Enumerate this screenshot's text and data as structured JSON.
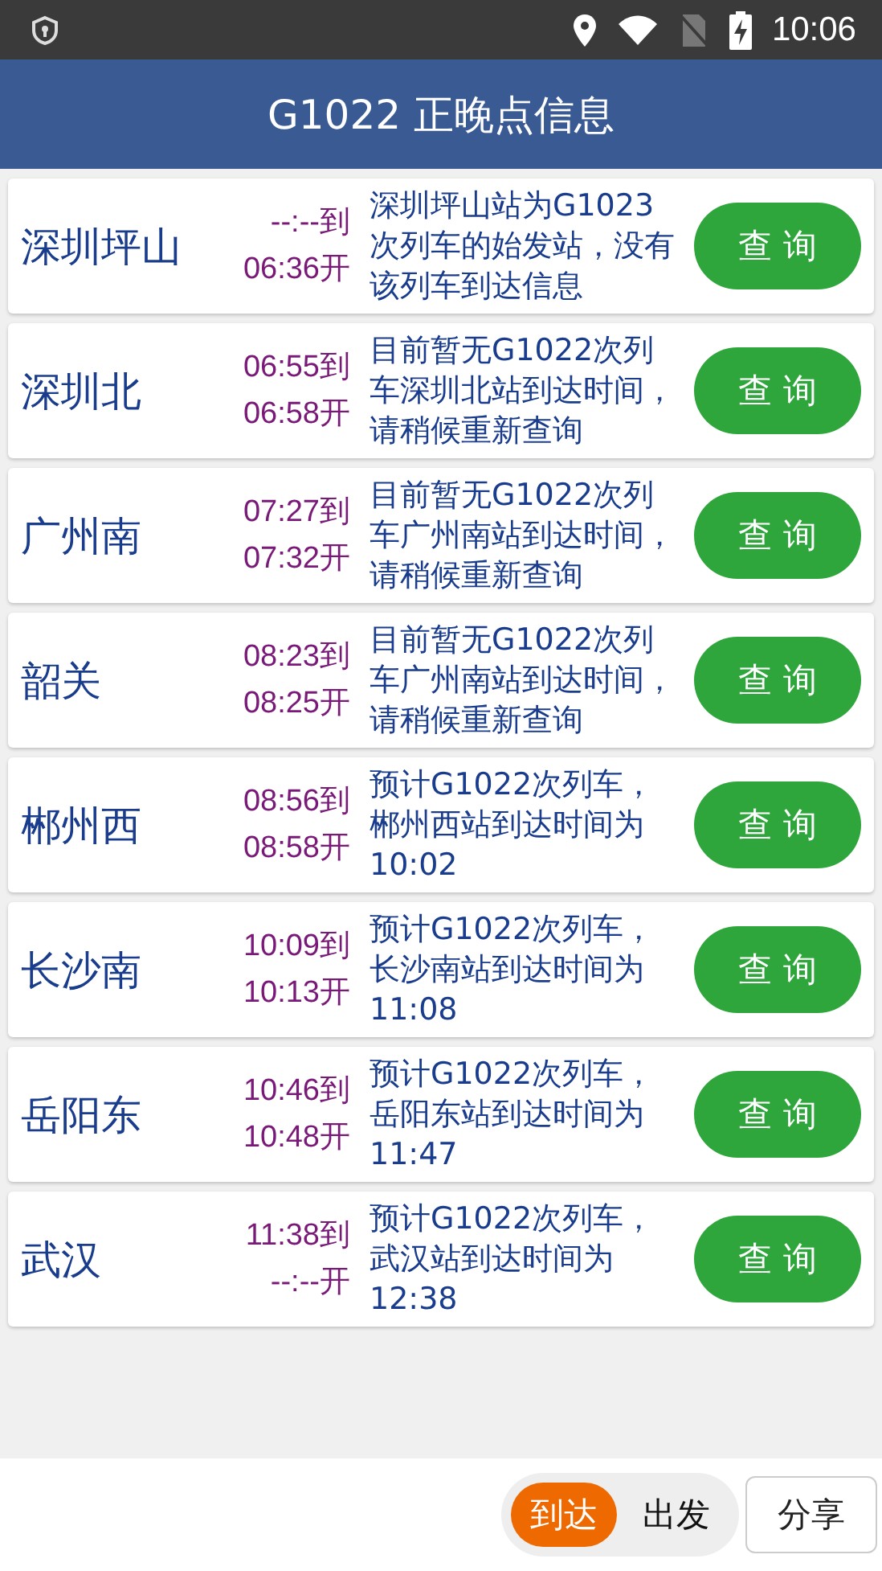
{
  "status_bar": {
    "time": "10:06"
  },
  "header": {
    "title": "G1022 正晚点信息"
  },
  "stations": [
    {
      "name": "深圳坪山",
      "arrive": "--:--到",
      "depart": "06:36开",
      "message": "深圳坪山站为G1023次列车的始发站，没有该列车到达信息",
      "button": "查 询"
    },
    {
      "name": "深圳北",
      "arrive": "06:55到",
      "depart": "06:58开",
      "message": "目前暂无G1022次列车深圳北站到达时间，请稍候重新查询",
      "button": "查 询"
    },
    {
      "name": "广州南",
      "arrive": "07:27到",
      "depart": "07:32开",
      "message": "目前暂无G1022次列车广州南站到达时间，请稍候重新查询",
      "button": "查 询"
    },
    {
      "name": "韶关",
      "arrive": "08:23到",
      "depart": "08:25开",
      "message": "目前暂无G1022次列车广州南站到达时间，请稍候重新查询",
      "button": "查 询"
    },
    {
      "name": "郴州西",
      "arrive": "08:56到",
      "depart": "08:58开",
      "message": "预计G1022次列车，郴州西站到达时间为10:02",
      "button": "查 询"
    },
    {
      "name": "长沙南",
      "arrive": "10:09到",
      "depart": "10:13开",
      "message": "预计G1022次列车，长沙南站到达时间为11:08",
      "button": "查 询"
    },
    {
      "name": "岳阳东",
      "arrive": "10:46到",
      "depart": "10:48开",
      "message": "预计G1022次列车，岳阳东站到达时间为11:47",
      "button": "查 询"
    },
    {
      "name": "武汉",
      "arrive": "11:38到",
      "depart": "--:--开",
      "message": "预计G1022次列车，武汉站到达时间为12:38",
      "button": "查 询"
    }
  ],
  "mode_toggle": [
    {
      "label": "到达",
      "selected": true
    },
    {
      "label": "出发",
      "selected": false
    }
  ],
  "share_button": "分享"
}
